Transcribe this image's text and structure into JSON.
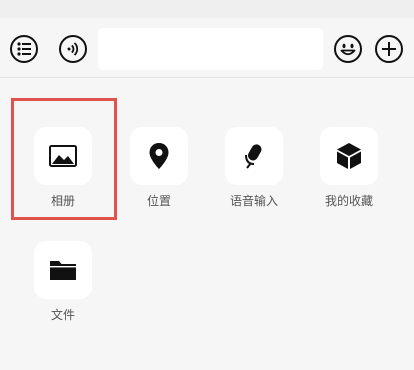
{
  "input_bar": {
    "list_button_icon": "list-icon",
    "voice_button_icon": "voice-icon",
    "message_value": "",
    "emoji_button_icon": "emoji-icon",
    "add_button_icon": "plus-icon"
  },
  "panel": {
    "items": [
      {
        "label": "相册",
        "icon": "photo-icon"
      },
      {
        "label": "位置",
        "icon": "location-pin-icon"
      },
      {
        "label": "语音输入",
        "icon": "microphone-icon"
      },
      {
        "label": "我的收藏",
        "icon": "cube-icon"
      },
      {
        "label": "文件",
        "icon": "folder-icon"
      }
    ]
  },
  "colors": {
    "background": "#f6f6f6",
    "tile_background": "#ffffff",
    "icon": "#111111",
    "label": "#555555",
    "highlight": "#e0534c"
  }
}
